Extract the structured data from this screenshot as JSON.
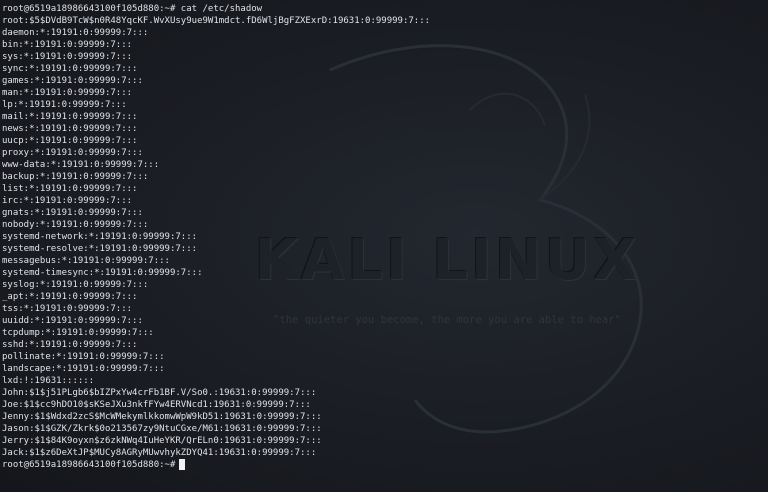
{
  "terminal": {
    "command_line": "root@6519a18986643100f105d880:~# cat /etc/shadow",
    "output_lines": [
      "root:$5$DVdB9TcW$n0R48YqcKF.WvXUsy9ue9W1mdct.fD6WljBgFZXExrD:19631:0:99999:7:::",
      "daemon:*:19191:0:99999:7:::",
      "bin:*:19191:0:99999:7:::",
      "sys:*:19191:0:99999:7:::",
      "sync:*:19191:0:99999:7:::",
      "games:*:19191:0:99999:7:::",
      "man:*:19191:0:99999:7:::",
      "lp:*:19191:0:99999:7:::",
      "mail:*:19191:0:99999:7:::",
      "news:*:19191:0:99999:7:::",
      "uucp:*:19191:0:99999:7:::",
      "proxy:*:19191:0:99999:7:::",
      "www-data:*:19191:0:99999:7:::",
      "backup:*:19191:0:99999:7:::",
      "list:*:19191:0:99999:7:::",
      "irc:*:19191:0:99999:7:::",
      "gnats:*:19191:0:99999:7:::",
      "nobody:*:19191:0:99999:7:::",
      "systemd-network:*:19191:0:99999:7:::",
      "systemd-resolve:*:19191:0:99999:7:::",
      "messagebus:*:19191:0:99999:7:::",
      "systemd-timesync:*:19191:0:99999:7:::",
      "syslog:*:19191:0:99999:7:::",
      "_apt:*:19191:0:99999:7:::",
      "tss:*:19191:0:99999:7:::",
      "uuidd:*:19191:0:99999:7:::",
      "tcpdump:*:19191:0:99999:7:::",
      "sshd:*:19191:0:99999:7:::",
      "pollinate:*:19191:0:99999:7:::",
      "landscape:*:19191:0:99999:7:::",
      "lxd:!:19631::::::",
      "John:$1$j51PLgb6$bIZPxYw4crFb1BF.V/So0.:19631:0:99999:7:::",
      "Joe:$1$cc9hDO10$sKSeJXu3nkfFYw4ERVNcd1:19631:0:99999:7:::",
      "Jenny:$1$Wdxd2zcS$McWMekymlkkomwWpW9kD51:19631:0:99999:7:::",
      "Jason:$1$GZK/Zkrk$0o213567zy9NtuCGxe/M61:19631:0:99999:7:::",
      "Jerry:$1$84K9oyxn$z6zkNWq4IuHeYKR/QrELn0:19631:0:99999:7:::",
      "Jack:$1$z6DeXtJP$MUCy8AGRyMUwvhykZDYQ41:19631:0:99999:7:::"
    ],
    "prompt": "root@6519a18986643100f105d880:~#"
  },
  "wallpaper": {
    "title": "KALI LINUX",
    "tagline": "\"the quieter you become, the more you are able to hear\""
  },
  "colors": {
    "background": "#1b1e25",
    "text": "#dfe3e8",
    "cursor": "#f2f2f2"
  }
}
